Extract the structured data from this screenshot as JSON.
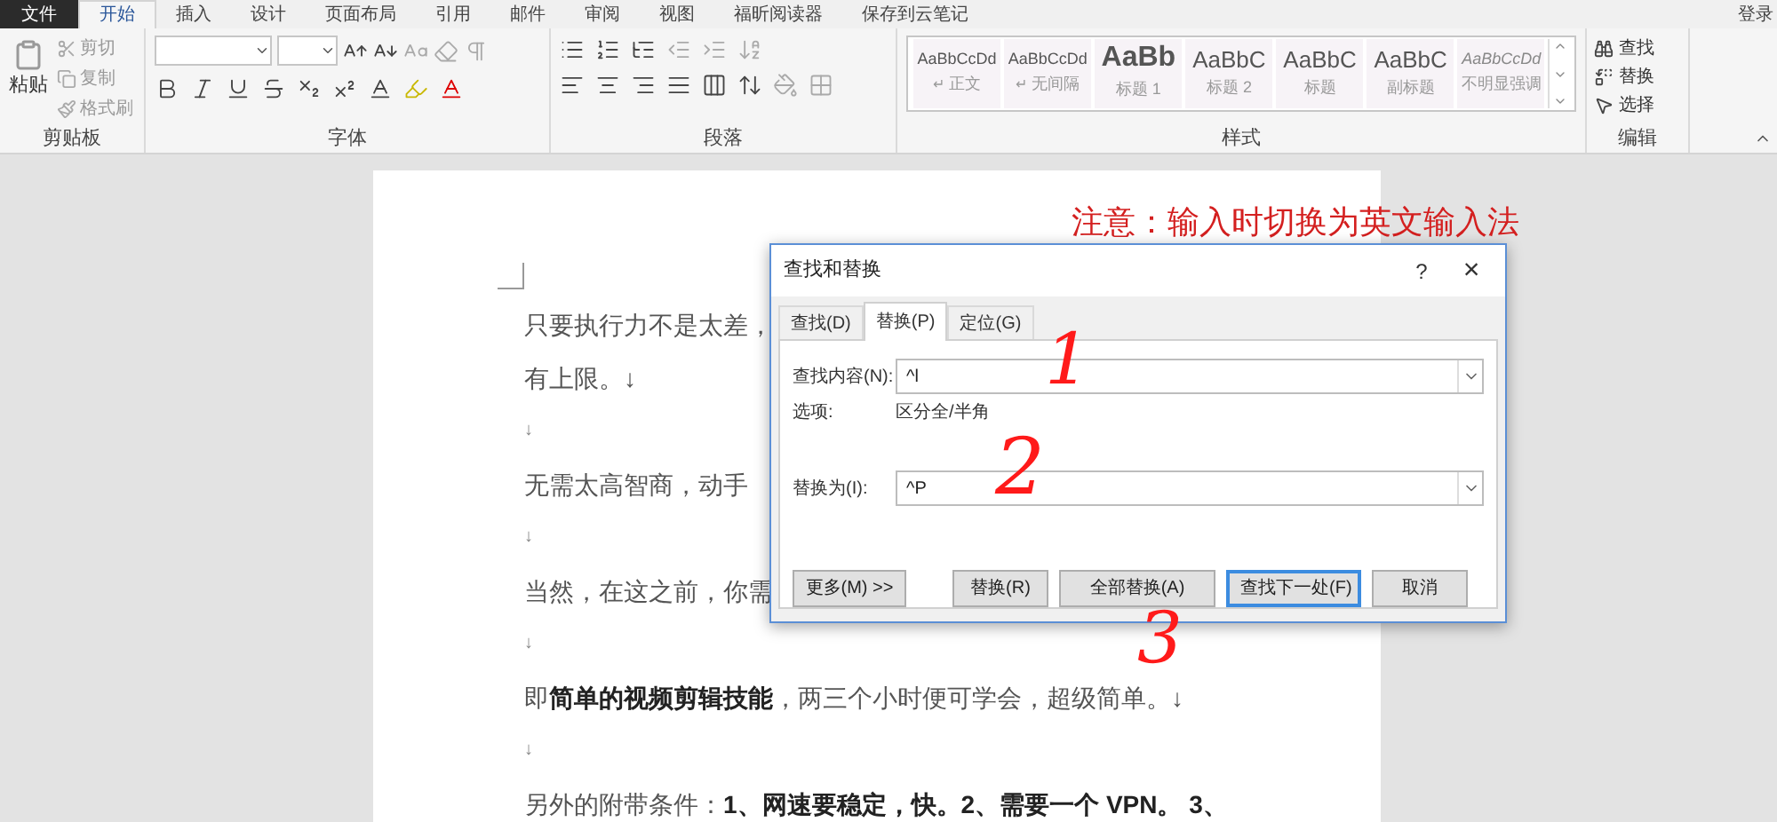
{
  "menu_tabs": [
    {
      "label": "文件",
      "kind": "file",
      "selected": false
    },
    {
      "label": "开始",
      "kind": "tab",
      "selected": true
    },
    {
      "label": "插入",
      "kind": "tab",
      "selected": false
    },
    {
      "label": "设计",
      "kind": "tab",
      "selected": false
    },
    {
      "label": "页面布局",
      "kind": "tab",
      "selected": false
    },
    {
      "label": "引用",
      "kind": "tab",
      "selected": false
    },
    {
      "label": "邮件",
      "kind": "tab",
      "selected": false
    },
    {
      "label": "审阅",
      "kind": "tab",
      "selected": false
    },
    {
      "label": "视图",
      "kind": "tab",
      "selected": false
    },
    {
      "label": "福昕阅读器",
      "kind": "tab",
      "selected": false
    },
    {
      "label": "保存到云笔记",
      "kind": "tab",
      "selected": false
    }
  ],
  "account": "登录",
  "clipboard": {
    "paste": "粘贴",
    "items": [
      "剪切",
      "复制",
      "格式刷"
    ],
    "label": "剪贴板"
  },
  "font": {
    "label": "字体"
  },
  "paragraph": {
    "label": "段落"
  },
  "styles": {
    "label": "样式",
    "items": [
      {
        "sample": "AaBbCcDd",
        "name": "正文",
        "kind": "body",
        "mark": "↵"
      },
      {
        "sample": "AaBbCcDd",
        "name": "无间隔",
        "kind": "body",
        "mark": "↵"
      },
      {
        "sample": "AaBb",
        "name": "标题 1",
        "kind": "heading"
      },
      {
        "sample": "AaBbC",
        "name": "标题 2",
        "kind": "large"
      },
      {
        "sample": "AaBbC",
        "name": "标题",
        "kind": "large"
      },
      {
        "sample": "AaBbC",
        "name": "副标题",
        "kind": "large"
      },
      {
        "sample": "AaBbCcDd",
        "name": "不明显强调",
        "kind": "emphasis"
      }
    ]
  },
  "editing": {
    "label": "编辑",
    "items": [
      {
        "label": "查找",
        "kind": "find"
      },
      {
        "label": "替换",
        "kind": "replace"
      },
      {
        "label": "选择",
        "kind": "select"
      }
    ]
  },
  "document": {
    "paragraphs": [
      {
        "kind": "text",
        "text": "只要执行力不是太差，"
      },
      {
        "kind": "text",
        "text": "有上限。↓"
      },
      {
        "kind": "mark",
        "text": "↓"
      },
      {
        "kind": "text",
        "text": "无需太高智商，动手"
      },
      {
        "kind": "mark",
        "text": "↓"
      },
      {
        "kind": "text",
        "text": "当然，在这之前，你需"
      },
      {
        "kind": "mark",
        "text": "↓"
      },
      {
        "kind": "text",
        "text": "即**简单的视频剪辑技能**，两三个小时便可学会，超级简单。↓"
      },
      {
        "kind": "mark",
        "text": "↓"
      },
      {
        "kind": "text",
        "text": "另外的附带条件：**1、网速要稳定，快。2、需要一个 VPN。 3、**"
      }
    ]
  },
  "annotation": "注意：输入时切换为英文输入法",
  "handwritten_marks": [
    "1",
    "2",
    "3"
  ],
  "dialog": {
    "title": "查找和替换",
    "help": "?",
    "close": "×",
    "tabs": [
      {
        "label": "查找(D)",
        "selected": false
      },
      {
        "label": "替换(P)",
        "selected": true
      },
      {
        "label": "定位(G)",
        "selected": false
      }
    ],
    "find_label": "查找内容(N):",
    "find_value": "^l",
    "options_label": "选项:",
    "options_value": "区分全/半角",
    "replace_label": "替换为(I):",
    "replace_value": "^P",
    "buttons": [
      {
        "label": "更多(M) >>",
        "default": false
      },
      {
        "label": "替换(R)",
        "default": false
      },
      {
        "label": "全部替换(A)",
        "default": false
      },
      {
        "label": "查找下一处(F)",
        "default": true
      },
      {
        "label": "取消",
        "default": false
      }
    ]
  }
}
